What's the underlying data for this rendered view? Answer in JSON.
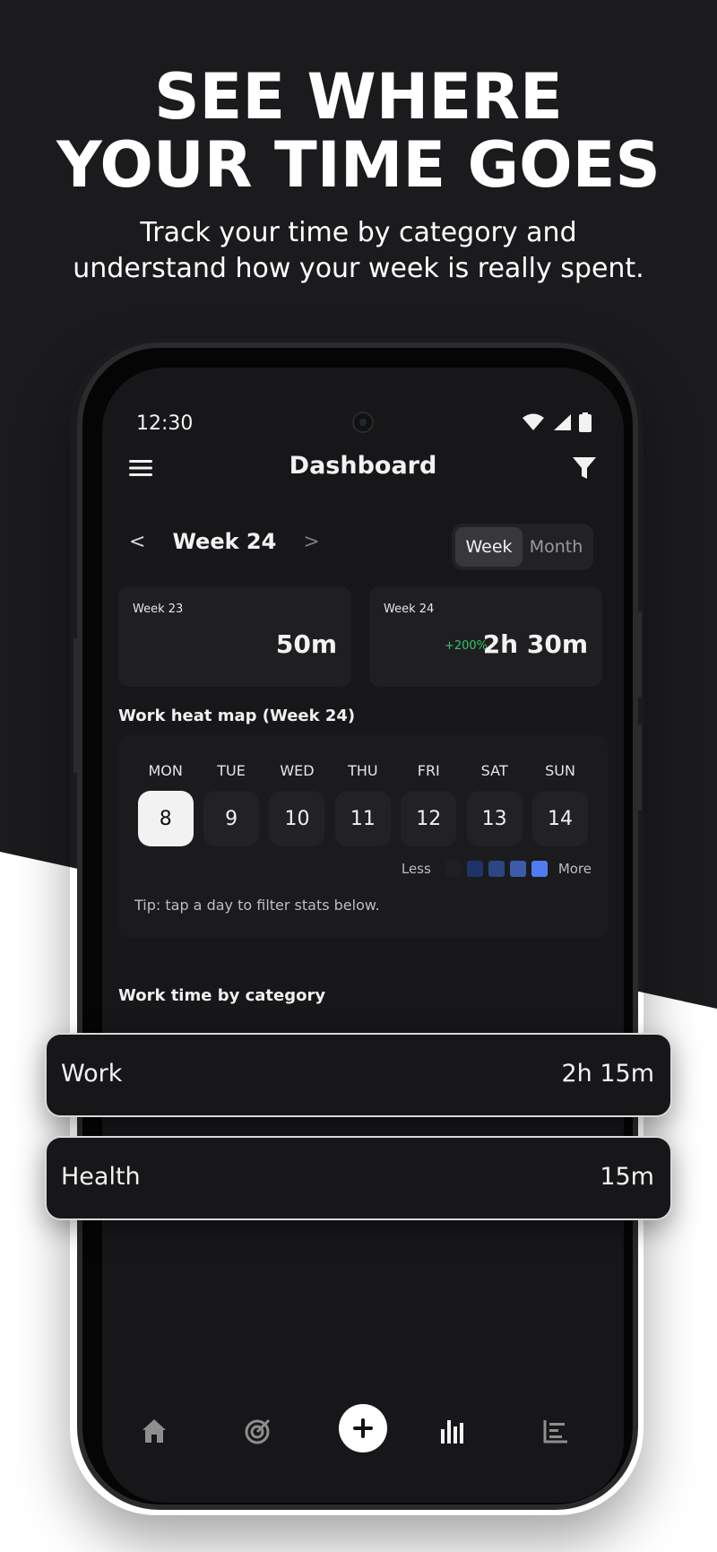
{
  "promo": {
    "headline_line1": "SEE WHERE",
    "headline_line2": "YOUR TIME GOES",
    "subline_line1": "Track your time by category and",
    "subline_line2": "understand how your week is really spent."
  },
  "status_bar": {
    "time": "12:30",
    "icons": [
      "wifi-icon",
      "signal-icon",
      "battery-icon"
    ]
  },
  "app_bar": {
    "title": "Dashboard",
    "left_icon": "menu-icon",
    "right_icon": "filter-icon"
  },
  "week_nav": {
    "prev": "<",
    "label": "Week 24",
    "next": ">"
  },
  "period_toggle": {
    "options": [
      "Week",
      "Month"
    ],
    "selected": "Week"
  },
  "summary_cards": [
    {
      "label": "Week 23",
      "value": "50m",
      "change": ""
    },
    {
      "label": "Week 24",
      "value": "2h 30m",
      "change": "+200%"
    }
  ],
  "heat_map": {
    "title": "Work heat map (Week 24)",
    "days": [
      {
        "name": "MON",
        "date": "8",
        "selected": true
      },
      {
        "name": "TUE",
        "date": "9",
        "selected": false
      },
      {
        "name": "WED",
        "date": "10",
        "selected": false
      },
      {
        "name": "THU",
        "date": "11",
        "selected": false
      },
      {
        "name": "FRI",
        "date": "12",
        "selected": false
      },
      {
        "name": "SAT",
        "date": "13",
        "selected": false
      },
      {
        "name": "SUN",
        "date": "14",
        "selected": false
      }
    ],
    "legend_less": "Less",
    "legend_more": "More",
    "legend_colors": [
      "#1f1f23",
      "#1e3368",
      "#2b4684",
      "#3c5cab",
      "#4f7cf2"
    ],
    "tip": "Tip: tap a day to filter stats below."
  },
  "category_section": {
    "title": "Work time by category",
    "items": [
      {
        "name": "Work",
        "value": "2h 15m"
      },
      {
        "name": "Health",
        "value": "15m"
      }
    ]
  },
  "bottom_nav": {
    "items": [
      "home-icon",
      "target-icon",
      "add-icon",
      "bar-chart-icon",
      "list-chart-icon"
    ],
    "selected": "bar-chart-icon"
  },
  "colors": {
    "screen_bg": "#17171a",
    "card_bg": "#1f1f22",
    "accent_green": "#34c36b",
    "heat_max": "#4f7cf2"
  }
}
